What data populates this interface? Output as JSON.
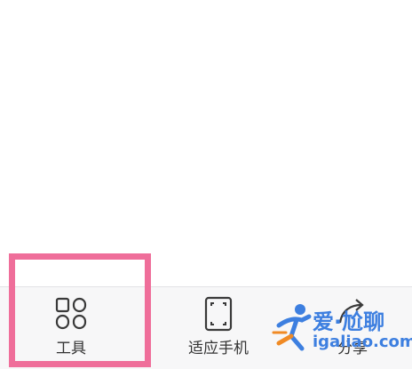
{
  "toolbar": {
    "items": [
      {
        "label": "工具",
        "icon": "grid-icon"
      },
      {
        "label": "适应手机",
        "icon": "fit-screen-icon"
      },
      {
        "label": "分享",
        "icon": "share-icon"
      }
    ]
  },
  "highlight": {
    "color": "#ef6e9a"
  },
  "watermark": {
    "brand": "爱·尬聊",
    "site": "igaliao.com",
    "color": "#3d7fe0",
    "accent": "#f08a24"
  }
}
